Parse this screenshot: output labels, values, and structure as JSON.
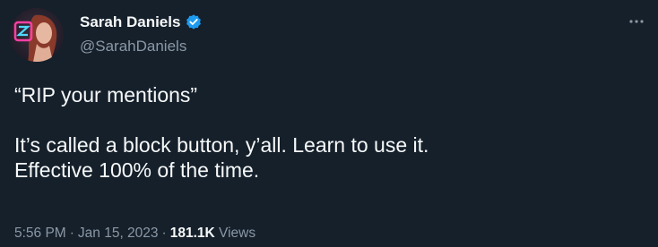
{
  "tweet": {
    "author": {
      "name": "Sarah Daniels",
      "handle": "@SarahDaniels",
      "verified": true,
      "avatar_icon": "avatar-icon"
    },
    "more_icon": "more-horizontal-icon",
    "text": {
      "line1": "“RIP your mentions”",
      "line2": "It’s called a block button, y’all. Learn to use it.",
      "line3": "Effective 100% of the time."
    },
    "meta": {
      "time": "5:56 PM",
      "separator": "·",
      "date": "Jan 15, 2023",
      "views_count": "181.1K",
      "views_label": "Views"
    }
  },
  "colors": {
    "background": "#15202b",
    "text_primary": "#f7f9f9",
    "text_secondary": "#8b98a5",
    "verified_blue": "#1d9bf0",
    "avatar_accent": "#e0245e"
  }
}
